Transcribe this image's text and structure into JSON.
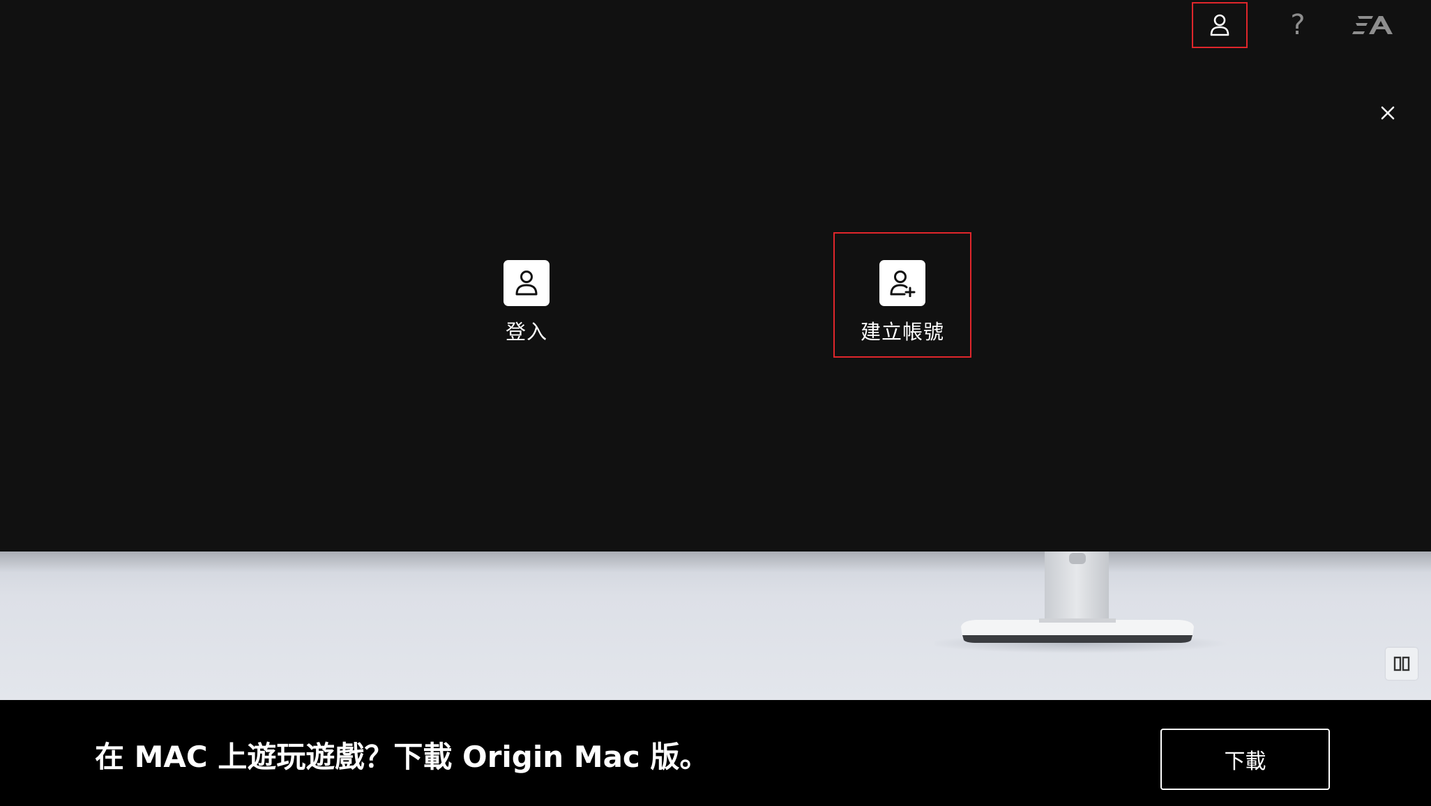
{
  "header": {
    "account_icon": "user-icon",
    "help_icon": "question-mark-icon",
    "help_glyph": "?",
    "logo": "EA",
    "close_icon": "close-icon"
  },
  "panel": {
    "options": [
      {
        "label": "登入",
        "icon": "user-icon"
      },
      {
        "label": "建立帳號",
        "icon": "user-add-icon"
      }
    ]
  },
  "hero": {
    "pause_icon": "pause-icon"
  },
  "banner": {
    "text": "在 MAC 上遊玩遊戲？下載 Origin Mac 版。",
    "button_label": "下載"
  },
  "colors": {
    "panel_bg": "#111111",
    "highlight": "#e0262b",
    "banner_bg": "#000000"
  }
}
